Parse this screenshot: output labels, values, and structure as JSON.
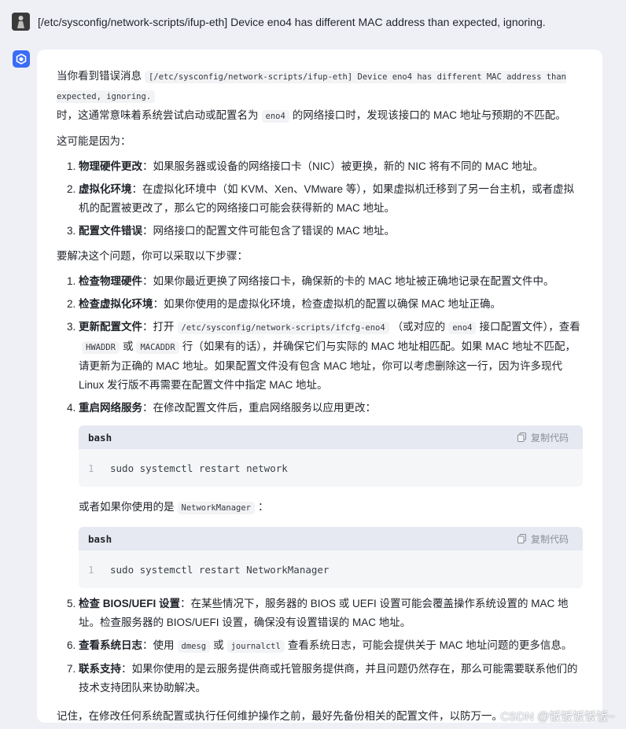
{
  "user": {
    "message": "[/etc/sysconfig/network-scripts/ifup-eth] Device eno4 has different MAC address than expected, ignoring."
  },
  "answer": {
    "intro_pre": "当你看到错误消息",
    "intro_code": "[/etc/sysconfig/network-scripts/ifup-eth] Device eno4 has different MAC address than expected, ignoring.",
    "intro_mid": "时，这通常意味着系统尝试启动或配置名为",
    "intro_code2": "eno4",
    "intro_post": "的网络接口时，发现该接口的 MAC 地址与预期的不匹配。",
    "causes_heading": "这可能是因为：",
    "causes": [
      {
        "num": "1.",
        "title": "物理硬件更改",
        "text": "：如果服务器或设备的网络接口卡（NIC）被更换，新的 NIC 将有不同的 MAC 地址。"
      },
      {
        "num": "2.",
        "title": "虚拟化环境",
        "text": "：在虚拟化环境中（如 KVM、Xen、VMware 等），如果虚拟机迁移到了另一台主机，或者虚拟机的配置被更改了，那么它的网络接口可能会获得新的 MAC 地址。"
      },
      {
        "num": "3.",
        "title": "配置文件错误",
        "text": "：网络接口的配置文件可能包含了错误的 MAC 地址。"
      }
    ],
    "steps_heading": "要解决这个问题，你可以采取以下步骤：",
    "steps": {
      "s1": {
        "num": "1.",
        "title": "检查物理硬件",
        "text": "：如果你最近更换了网络接口卡，确保新的卡的 MAC 地址被正确地记录在配置文件中。"
      },
      "s2": {
        "num": "2.",
        "title": "检查虚拟化环境",
        "text": "：如果你使用的是虚拟化环境，检查虚拟机的配置以确保 MAC 地址正确。"
      },
      "s3": {
        "num": "3.",
        "title": "更新配置文件",
        "t1": "：打开",
        "code1": "/etc/sysconfig/network-scripts/ifcfg-eno4",
        "t2": "（或对应的",
        "code2": "eno4",
        "t3": "接口配置文件），查看",
        "code3": "HWADDR",
        "t4": "或",
        "code4": "MACADDR",
        "t5": "行（如果有的话），并确保它们与实际的 MAC 地址相匹配。如果 MAC 地址不匹配，请更新为正确的 MAC 地址。如果配置文件没有包含 MAC 地址，你可以考虑删除这一行，因为许多现代 Linux 发行版不再需要在配置文件中指定 MAC 地址。"
      },
      "s4": {
        "num": "4.",
        "title": "重启网络服务",
        "text": "：在修改配置文件后，重启网络服务以应用更改："
      },
      "or_pre": "或者如果你使用的是",
      "or_code": "NetworkManager",
      "or_post": "：",
      "s5": {
        "num": "5.",
        "title": "检查 BIOS/UEFI 设置",
        "text": "：在某些情况下，服务器的 BIOS 或 UEFI 设置可能会覆盖操作系统设置的 MAC 地址。检查服务器的 BIOS/UEFI 设置，确保没有设置错误的 MAC 地址。"
      },
      "s6": {
        "num": "6.",
        "title": "查看系统日志",
        "t1": "：使用",
        "code1": "dmesg",
        "t2": "或",
        "code2": "journalctl",
        "t3": "查看系统日志，可能会提供关于 MAC 地址问题的更多信息。"
      },
      "s7": {
        "num": "7.",
        "title": "联系支持",
        "text": "：如果你使用的是云服务提供商或托管服务提供商，并且问题仍然存在，那么可能需要联系他们的技术支持团队来协助解决。"
      }
    },
    "code_blocks": [
      {
        "lang": "bash",
        "copy_label": "复制代码",
        "line_no": "1",
        "code": "sudo systemctl restart network"
      },
      {
        "lang": "bash",
        "copy_label": "复制代码",
        "line_no": "1",
        "code": "sudo systemctl restart NetworkManager"
      }
    ],
    "closing": "记住，在修改任何系统配置或执行任何维护操作之前，最好先备份相关的配置文件，以防万一。"
  },
  "watermark": "CSDN @饭饭饭饭饭~",
  "colors": {
    "bot_avatar": "#3b6cf6",
    "page_bg": "#eef0f6",
    "card_bg": "#ffffff",
    "code_header": "#e6e9f1"
  }
}
